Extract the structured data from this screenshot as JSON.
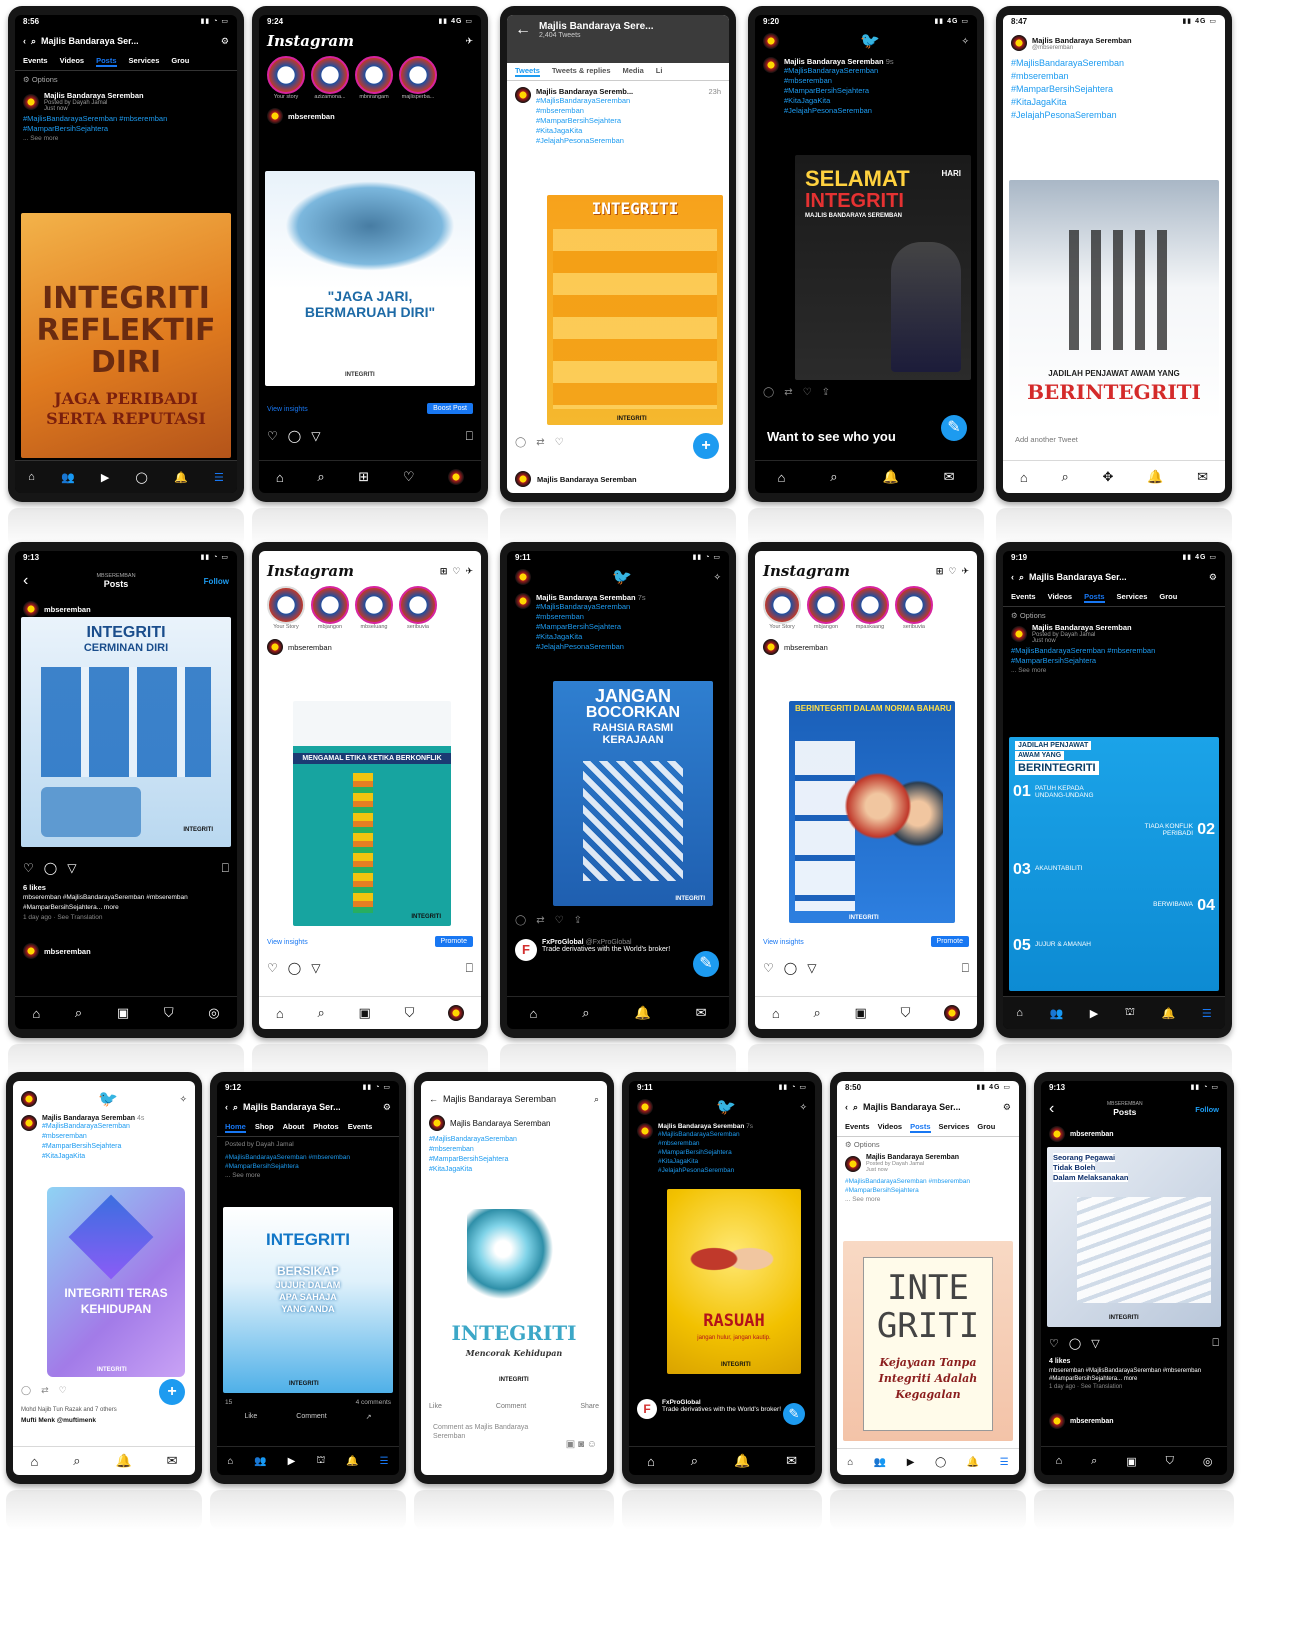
{
  "phones": {
    "p1": {
      "time": "8:56",
      "page": "Majlis Bandaraya Ser...",
      "tabs": [
        "Events",
        "Videos",
        "Posts",
        "Services",
        "Grou"
      ],
      "options": "Options",
      "author": "Majlis Bandaraya Seremban",
      "posted_by": "Posted by Dayah Jamal",
      "just_now": "Just now",
      "hashtags": "#MajlisBandarayaSeremban #mbseremban #MamparBersihSejahtera",
      "see_more": "... See more",
      "poster": [
        "INTEGRITI",
        "REFLEKTIF",
        "DIRI",
        "JAGA PERIBADI",
        "SERTA REPUTASI"
      ]
    },
    "p2": {
      "time": "9:24",
      "logo": "Instagram",
      "stories": [
        "Your story",
        "azizamona...",
        "mbnrangam",
        "majlisperba..."
      ],
      "user": "mbseremban",
      "poster": [
        "\"JAGA JARI,",
        "BERMARUAH DIRI\""
      ],
      "insights": "View insights",
      "boost": "Boost Post"
    },
    "p3": {
      "page": "Majlis Bandaraya Sere...",
      "count": "2,404 Tweets",
      "tabs": [
        "Tweets",
        "Tweets & replies",
        "Media",
        "Li"
      ],
      "author": "Majlis Bandaraya Seremb...",
      "when": "23h",
      "hashtags": [
        "#MajlisBandarayaSeremban",
        "#mbseremban",
        "#MamparBersihSejahtera",
        "#KitaJagaKita",
        "#JelajahPesonaSeremban"
      ],
      "poster": "INTEGRITI",
      "footer_author": "Majlis Bandaraya Seremban"
    },
    "p4": {
      "time": "9:20",
      "author": "Majlis Bandaraya Seremban",
      "when": "9s",
      "hashtags": [
        "#MajlisBandarayaSeremban",
        "#mbseremban",
        "#MamparBersihSejahtera",
        "#KitaJagaKita",
        "#JelajahPesonaSeremban"
      ],
      "poster": [
        "SELAMAT",
        "HARI",
        "INTEGRITI",
        "MAJLIS BANDARAYA SEREMBAN"
      ],
      "prompt": "Want to see who you"
    },
    "p5": {
      "time": "8:47",
      "author": "Majlis Bandaraya Seremban",
      "handle": "@mbseremban",
      "hashtags": [
        "#MajlisBandarayaSeremban",
        "#mbseremban",
        "#MamparBersihSejahtera",
        "#KitaJagaKita",
        "#JelajahPesonaSeremban"
      ],
      "poster": [
        "JADILAH PENJAWAT AWAM YANG",
        "BERINTEGRITI"
      ],
      "add": "Add another Tweet"
    },
    "p6": {
      "time": "9:13",
      "section": "MBSEREMBAN",
      "title": "Posts",
      "follow": "Follow",
      "user": "mbseremban",
      "poster": [
        "INTEGRITI",
        "CERMINAN DIRI"
      ],
      "likes": "6 likes",
      "caption": "mbseremban #MajlisBandarayaSeremban #mbseremban #MamparBersihSejahtera... more",
      "when": "1 day ago",
      "translation": "See Translation",
      "comment_user": "mbseremban"
    },
    "p7": {
      "logo": "Instagram",
      "stories": [
        "Your Story",
        "mbjangon",
        "mbseluang",
        "seribuvia"
      ],
      "user": "mbseremban",
      "poster": "MENGAMAL ETIKA KETIKA BERKONFLIK",
      "insights": "View insights",
      "promote": "Promote"
    },
    "p8": {
      "time": "9:11",
      "author": "Majlis Bandaraya Seremban",
      "when": "7s",
      "hashtags": [
        "#MajlisBandarayaSeremban",
        "#mbseremban",
        "#MamparBersihSejahtera",
        "#KitaJagaKita",
        "#JelajahPesonaSeremban"
      ],
      "poster": [
        "JANGAN",
        "BOCORKAN",
        "RAHSIA RASMI",
        "KERAJAAN"
      ],
      "promo_author": "FxProGlobal",
      "promo_handle": "@FxProGlobal",
      "promo_text": "Trade derivatives with the World's broker!"
    },
    "p9": {
      "logo": "Instagram",
      "stories": [
        "Your Story",
        "mbjangon",
        "mpaskaang",
        "seribuvia"
      ],
      "user": "mbseremban",
      "poster": "BERINTEGRITI DALAM NORMA BAHARU",
      "insights": "View insights",
      "promote": "Promote"
    },
    "p10": {
      "time": "9:19",
      "page": "Majlis Bandaraya Ser...",
      "tabs": [
        "Events",
        "Videos",
        "Posts",
        "Services",
        "Grou"
      ],
      "options": "Options",
      "author": "Majlis Bandaraya Seremban",
      "posted_by": "Posted by Dayah Jamal",
      "just_now": "Just now",
      "hashtags": "#MajlisBandarayaSeremban #mbseremban #MamparBersihSejahtera",
      "see_more": "... See more",
      "poster": [
        "JADILAH PENJAWAT",
        "AWAM YANG",
        "BERINTEGRITI",
        "PATUH KEPADA UNDANG-UNDANG",
        "TIADA KONFLIK PERIBADI",
        "AKAUNTABILITI",
        "BERWIBAWA",
        "JUJUR & AMANAH"
      ],
      "nums": [
        "01",
        "02",
        "03",
        "04",
        "05"
      ]
    },
    "p11": {
      "author": "Majlis Bandaraya Seremban",
      "when": "4s",
      "hashtags": [
        "#MajlisBandarayaSeremban",
        "#mbseremban",
        "#MamparBersihSejahtera",
        "#KitaJagaKita"
      ],
      "poster": [
        "INTEGRITI TERAS",
        "KEHIDUPAN"
      ],
      "reply1": "Mohd Najib Tun Razak and 7 others",
      "reply2": "Mufti Menk @muftimenk"
    },
    "p12": {
      "time": "9:12",
      "page": "Majlis Bandaraya Ser...",
      "tabs": [
        "Home",
        "Shop",
        "About",
        "Photos",
        "Events"
      ],
      "posted_by": "Posted by Dayah Jamal",
      "hashtags": "#MajlisBandarayaSeremban #mbseremban #MamparBersihSejahtera",
      "see_more": "... See more",
      "poster": [
        "INTEGRITI",
        "BERSIKAP",
        "JUJUR DALAM",
        "APA SAHAJA",
        "YANG ANDA"
      ],
      "reactions": "15",
      "comments": "4 comments",
      "like": "Like",
      "comment": "Comment"
    },
    "p13": {
      "page": "Majlis Bandaraya Seremban",
      "author": "Majlis Bandaraya Seremban",
      "hashtags": [
        "#MajlisBandarayaSeremban",
        "#mbseremban",
        "#MamparBersihSejahtera",
        "#KitaJagaKita"
      ],
      "poster": [
        "INTEGRITI",
        "Mencorak Kehidupan"
      ],
      "like": "Like",
      "comment": "Comment",
      "share": "Share",
      "comment_as": "Comment as Majlis Bandaraya Seremban"
    },
    "p14": {
      "time": "9:11",
      "author": "Majlis Bandaraya Seremban",
      "when": "7s",
      "hashtags": [
        "#MajlisBandarayaSeremban",
        "#mbseremban",
        "#MamparBersihSejahtera",
        "#KitaJagaKita",
        "#JelajahPesonaSeremban"
      ],
      "poster": [
        "RASUAH",
        "jangan hulur, jangan kautip."
      ],
      "promo_author": "FxProGlobal",
      "promo_text": "Trade derivatives with the World's broker!"
    },
    "p15": {
      "time": "8:50",
      "page": "Majlis Bandaraya Ser...",
      "tabs": [
        "Events",
        "Videos",
        "Posts",
        "Services",
        "Grou"
      ],
      "options": "Options",
      "author": "Majlis Bandaraya Seremban",
      "posted_by": "Posted by Dayah Jamal",
      "just_now": "Just now",
      "hashtags": "#MajlisBandarayaSeremban #mbseremban #MamparBersihSejahtera",
      "see_more": "... See more",
      "poster": [
        "INTE",
        "GRITI",
        "Kejayaan Tanpa",
        "Integriti Adalah",
        "Kegagalan"
      ]
    },
    "p16": {
      "time": "9:13",
      "section": "MBSEREMBAN",
      "title": "Posts",
      "follow": "Follow",
      "user": "mbseremban",
      "poster": [
        "Seorang Pegawai",
        "Tidak Boleh",
        "Dalam Melaksanakan"
      ],
      "likes": "4 likes",
      "caption": "mbseremban #MajlisBandarayaSeremban #mbseremban #MamparBersihSejahtera... more",
      "when": "1 day ago",
      "translation": "See Translation",
      "comment_user": "mbseremban"
    }
  },
  "badges": {
    "integriti": "INTEGRITI"
  },
  "icons": {
    "back": "back-arrow-icon",
    "search": "search-icon",
    "settings": "gear-icon",
    "twitter": "twitter-bird-icon",
    "home": "home-icon",
    "heart": "heart-icon",
    "comment": "comment-icon",
    "send": "send-icon",
    "bookmark": "bookmark-icon",
    "compose": "compose-icon",
    "add": "add-icon"
  },
  "colors": {
    "facebook_blue": "#1877f2",
    "twitter_blue": "#1d9bf0",
    "instagram_pink": "#d6249f"
  }
}
